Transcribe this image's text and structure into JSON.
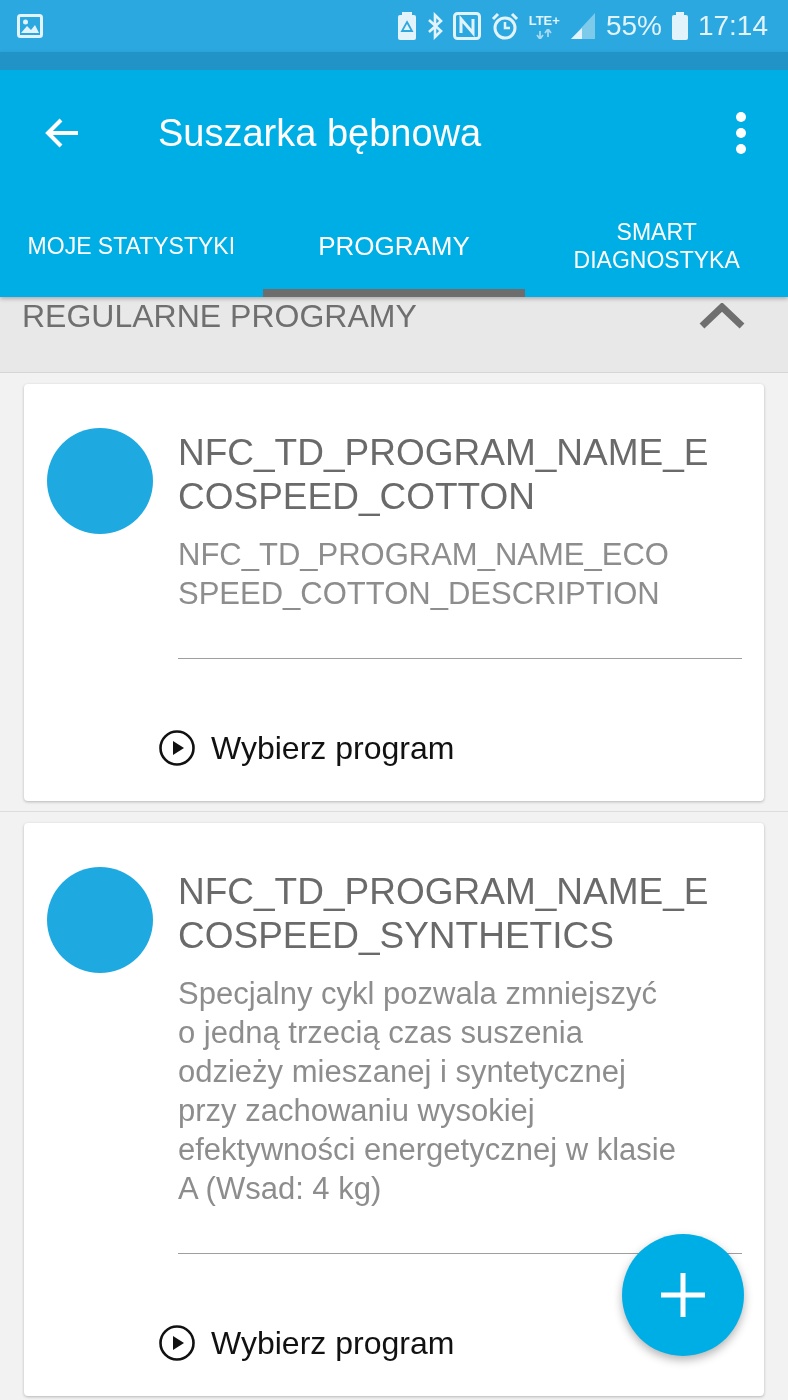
{
  "status_bar": {
    "network": "LTE+",
    "battery": "55%",
    "time": "17:14"
  },
  "app_bar": {
    "title": "Suszarka bębnowa"
  },
  "tabs": [
    {
      "label": "MOJE STATYSTYKI",
      "selected": false
    },
    {
      "label": "PROGRAMY",
      "selected": true
    },
    {
      "label": "SMART DIAGNOSTYKA",
      "selected": false
    }
  ],
  "section": {
    "title": "REGULARNE PROGRAMY",
    "expanded": true
  },
  "programs": [
    {
      "name": "NFC_TD_PROGRAM_NAME_ECOSPEED_COTTON",
      "description": "NFC_TD_PROGRAM_NAME_ECOSPEED_COTTON_DESCRIPTION",
      "action": "Wybierz program"
    },
    {
      "name": "NFC_TD_PROGRAM_NAME_ECOSPEED_SYNTHETICS",
      "description": "Specjalny cykl pozwala zmniejszyć o jedną trzecią czas suszenia odzieży mieszanej i syntetycznej przy zachowaniu wysokiej efektywności energetycznej w klasie A (Wsad: 4 kg)",
      "action": "Wybierz program"
    }
  ]
}
